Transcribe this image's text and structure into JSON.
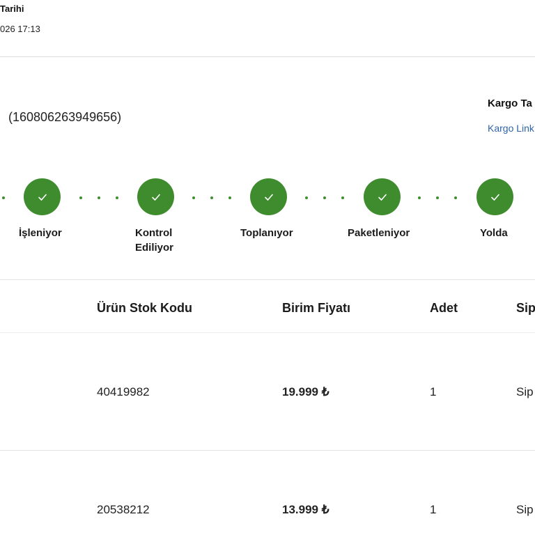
{
  "order_info": {
    "date_label": "Tarihi",
    "date_value": "026 17:13"
  },
  "shipment": {
    "code": "(160806263949656)",
    "cargo_title": "Kargo Ta",
    "cargo_link": "Kargo Link"
  },
  "tracker": {
    "accent_color": "#3f8c2f",
    "steps": [
      {
        "label_line1": "İşleniyor",
        "label_line2": "",
        "completed": true
      },
      {
        "label_line1": "Kontrol",
        "label_line2": "Ediliyor",
        "completed": true
      },
      {
        "label_line1": "Toplanıyor",
        "label_line2": "",
        "completed": true
      },
      {
        "label_line1": "Paketleniyor",
        "label_line2": "",
        "completed": true
      },
      {
        "label_line1": "Yolda",
        "label_line2": "",
        "completed": true
      }
    ]
  },
  "table": {
    "headers": [
      "Ürün Stok Kodu",
      "Birim Fiyatı",
      "Adet",
      "Sip"
    ],
    "rows": [
      {
        "stock_code": "40419982",
        "unit_price": "19.999 ₺",
        "quantity": "1",
        "status": "Sip"
      },
      {
        "stock_code": "20538212",
        "unit_price": "13.999 ₺",
        "quantity": "1",
        "status": "Sip"
      }
    ]
  }
}
